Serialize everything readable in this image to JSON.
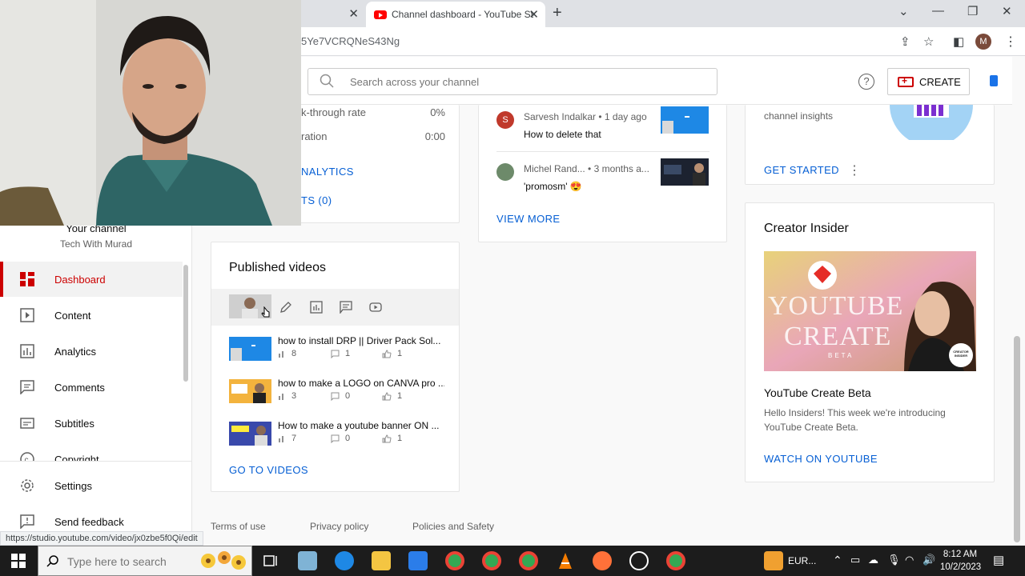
{
  "browser": {
    "active_tab_title": "Channel dashboard - YouTube Studio",
    "url_fragment": "5Ye7VCRQNeS43Ng",
    "profile_initial": "M"
  },
  "header": {
    "search_placeholder": "Search across your channel",
    "create_label": "CREATE",
    "help_label": "?"
  },
  "sidebar": {
    "channel_label": "Your channel",
    "channel_handle": "Tech With Murad",
    "items": [
      {
        "label": "Dashboard",
        "icon": "dashboard-icon",
        "active": true
      },
      {
        "label": "Content",
        "icon": "content-icon",
        "active": false
      },
      {
        "label": "Analytics",
        "icon": "analytics-icon",
        "active": false
      },
      {
        "label": "Comments",
        "icon": "comments-icon",
        "active": false
      },
      {
        "label": "Subtitles",
        "icon": "subtitles-icon",
        "active": false
      },
      {
        "label": "Copyright",
        "icon": "copyright-icon",
        "active": false
      },
      {
        "label": "Settings",
        "icon": "gear-icon",
        "active": false
      },
      {
        "label": "Send feedback",
        "icon": "feedback-icon",
        "active": false
      }
    ]
  },
  "analytics_card": {
    "stats": [
      {
        "label": "k-through rate",
        "value": "0%"
      },
      {
        "label": "ration",
        "value": "0:00"
      }
    ],
    "link_analytics": "NALYTICS",
    "link_trending": "TS (0)"
  },
  "comments_card": {
    "comments": [
      {
        "author_initial": "S",
        "meta": "Sarvesh Indalkar • 1 day ago",
        "text": "How to delete that"
      },
      {
        "author_initial": "",
        "meta": "Michel Rand... • 3 months a...",
        "text": "'promosm' 😍"
      }
    ],
    "view_more": "VIEW MORE"
  },
  "insights_card": {
    "text": "channel insights",
    "cta": "GET STARTED",
    "more": "⋮"
  },
  "published_card": {
    "title": "Published videos",
    "videos": [
      {
        "title": "how to install DRP || Driver Pack Sol...",
        "views": "8",
        "comments": "1",
        "likes": "1"
      },
      {
        "title": "how to make a LOGO on CANVA pro ...",
        "views": "3",
        "comments": "0",
        "likes": "1"
      },
      {
        "title": "How to make a youtube banner ON ...",
        "views": "7",
        "comments": "0",
        "likes": "1"
      }
    ],
    "go_to_videos": "GO TO VIDEOS"
  },
  "creator_card": {
    "title": "Creator Insider",
    "banner_line1": "YOUTUBE",
    "banner_line2": "CREATE",
    "banner_line3": "BETA",
    "badge": "CREATOR INSIDER",
    "subtitle": "YouTube Create Beta",
    "description": "Hello Insiders! This week we're introducing YouTube Create Beta.",
    "cta": "WATCH ON YOUTUBE"
  },
  "footer": {
    "links": [
      "Terms of use",
      "Privacy policy",
      "Policies and Safety"
    ]
  },
  "status_url": "https://studio.youtube.com/video/jx0zbe5f0Qi/edit",
  "taskbar": {
    "search_placeholder": "Type here to search",
    "currency": "EUR...",
    "time": "8:12 AM",
    "date": "10/2/2023"
  },
  "colors": {
    "accent_red": "#cc0000",
    "link_blue": "#065fd4",
    "yt_red": "#ff0000"
  }
}
